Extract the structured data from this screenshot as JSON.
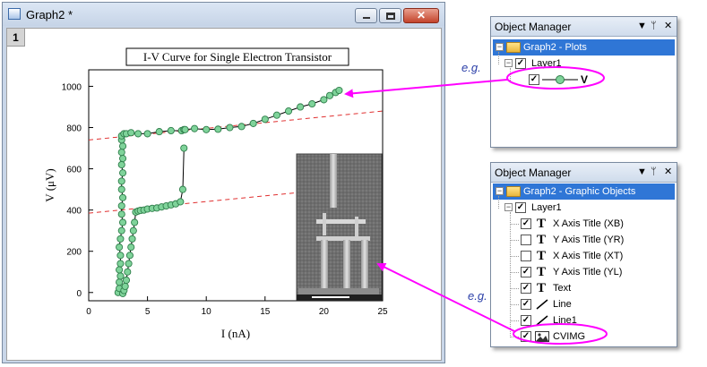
{
  "graph_window": {
    "title": "Graph2 *",
    "layer_tab": "1",
    "close_glyph": "✕"
  },
  "chart_data": {
    "type": "scatter",
    "title": "I-V Curve for Single Electron Transistor",
    "xlabel": "I (nA)",
    "ylabel": "V (μV)",
    "xlim": [
      0,
      25
    ],
    "ylim": [
      -40,
      1080
    ],
    "xticks": [
      0,
      5,
      10,
      15,
      20,
      25
    ],
    "yticks": [
      0,
      200,
      400,
      600,
      800,
      1000
    ],
    "grid": false,
    "series": [
      {
        "marker_color": "#7fd39a",
        "marker_edge": "#2e7d4a",
        "x": [
          2.5,
          2.6,
          2.6,
          2.7,
          2.6,
          2.7,
          2.7,
          2.6,
          2.7,
          2.8,
          2.9,
          2.8,
          2.8,
          2.9,
          2.8,
          2.8,
          2.9,
          2.8,
          2.9,
          2.8,
          2.9,
          2.8,
          2.8,
          3.0,
          3.2,
          3.6,
          4.2,
          5.0,
          6.0,
          7.0,
          7.9,
          8.1,
          8.2,
          9.0,
          10.0,
          11.0,
          12.0,
          13.0,
          14.0,
          15.0,
          16.0,
          17.0,
          18.0,
          19.0,
          20.0,
          20.5,
          21.0,
          21.3
        ],
        "y": [
          0,
          20,
          50,
          80,
          110,
          140,
          180,
          220,
          260,
          300,
          340,
          380,
          420,
          460,
          500,
          540,
          580,
          620,
          650,
          680,
          710,
          740,
          760,
          770,
          770,
          775,
          770,
          770,
          780,
          785,
          785,
          790,
          790,
          795,
          790,
          792,
          800,
          805,
          820,
          840,
          860,
          880,
          900,
          915,
          935,
          955,
          970,
          980
        ]
      },
      {
        "marker_color": "#7fd39a",
        "marker_edge": "#2e7d4a",
        "x": [
          2.9,
          3.0,
          3.1,
          3.2,
          3.3,
          3.4,
          3.5,
          3.6,
          3.7,
          3.8,
          3.9,
          4.0,
          4.2,
          4.4,
          4.7,
          5.0,
          5.4,
          5.8,
          6.2,
          6.6,
          7.0,
          7.4,
          7.8,
          8.0,
          8.1
        ],
        "y": [
          -5,
          10,
          30,
          60,
          100,
          140,
          180,
          220,
          260,
          300,
          340,
          390,
          395,
          398,
          400,
          405,
          408,
          410,
          415,
          420,
          425,
          430,
          440,
          500,
          700
        ]
      }
    ],
    "reference_lines": [
      {
        "x": [
          0,
          25
        ],
        "y": [
          740,
          880
        ],
        "color": "#e03030",
        "dash": true
      },
      {
        "x": [
          0,
          25
        ],
        "y": [
          385,
          525
        ],
        "color": "#e03030",
        "dash": true
      }
    ],
    "inset": {
      "image": "SEM micrograph of single electron transistor"
    }
  },
  "om_plots": {
    "title": "Object Manager",
    "pin_glyph": "ᛘ",
    "dropdown_glyph": "▼",
    "close_glyph": "✕",
    "root": "Graph2 - Plots",
    "layer": "Layer1",
    "plot_item": "V",
    "expander": "−",
    "check": "✓"
  },
  "om_graphic": {
    "title": "Object Manager",
    "pin_glyph": "ᛘ",
    "dropdown_glyph": "▼",
    "close_glyph": "✕",
    "root": "Graph2 - Graphic Objects",
    "layer": "Layer1",
    "expander": "−",
    "check": "✓",
    "items": [
      {
        "label": "X Axis Title (XB)",
        "checked": true,
        "icon": "text-icon"
      },
      {
        "label": "Y Axis Title (YR)",
        "checked": false,
        "icon": "text-icon"
      },
      {
        "label": "X Axis Title (XT)",
        "checked": false,
        "icon": "text-icon"
      },
      {
        "label": "Y Axis Title (YL)",
        "checked": true,
        "icon": "text-icon"
      },
      {
        "label": "Text",
        "checked": true,
        "icon": "text-icon"
      },
      {
        "label": "Line",
        "checked": true,
        "icon": "line-icon"
      },
      {
        "label": "Line1",
        "checked": true,
        "icon": "line-icon"
      },
      {
        "label": "CVIMG",
        "checked": true,
        "icon": "image-icon"
      }
    ]
  },
  "annotations": {
    "eg1": "e.g.",
    "eg2": "e.g.",
    "color": "#ff00ff"
  }
}
